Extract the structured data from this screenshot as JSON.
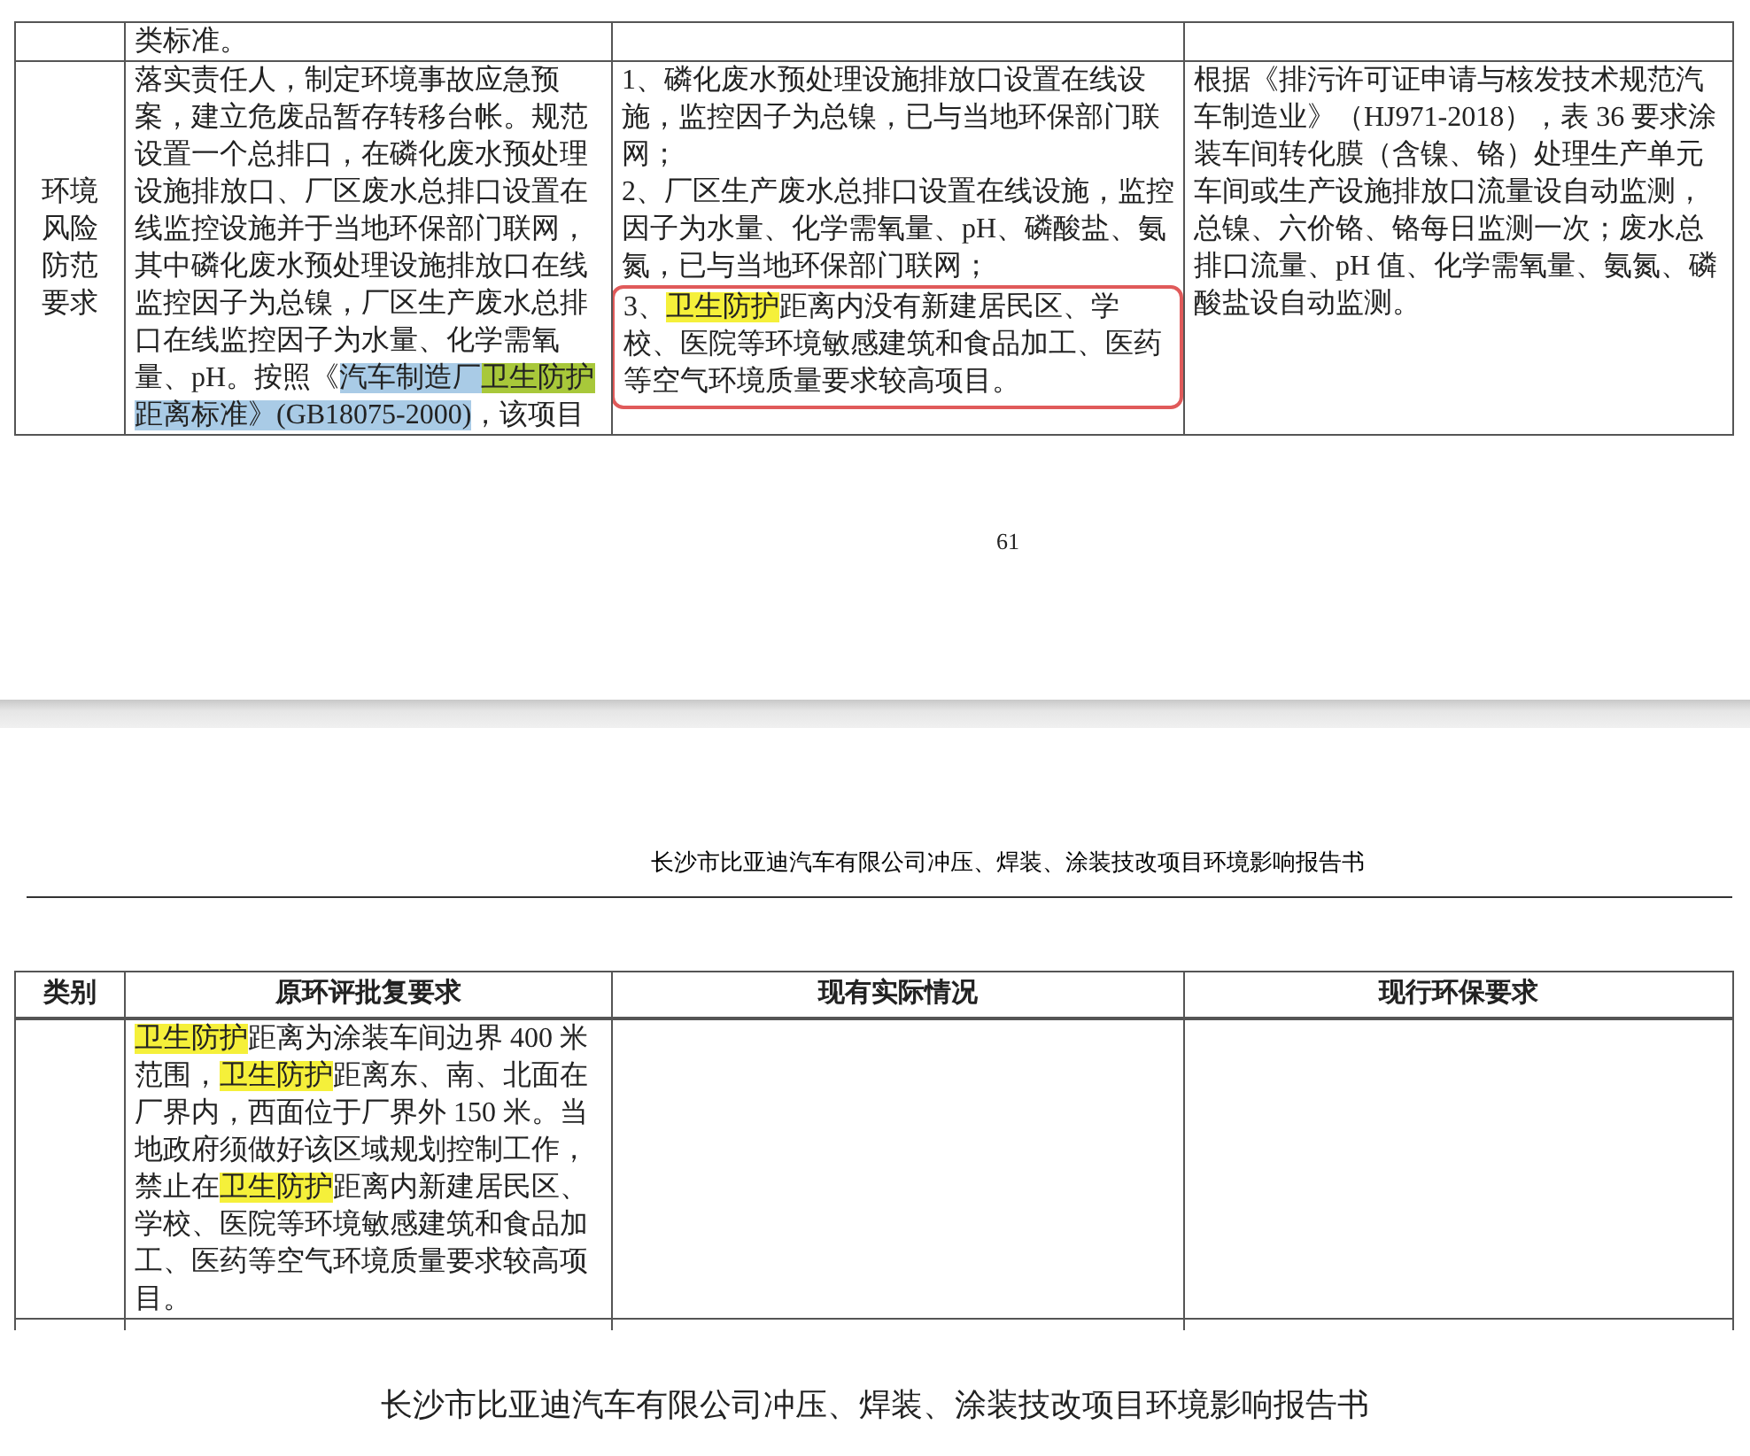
{
  "page_top": {
    "table": {
      "rows": [
        {
          "cells": [
            [],
            [
              {
                "segments": [
                  {
                    "text": "类标准。"
                  }
                ],
                "boxed": false
              }
            ],
            [],
            []
          ]
        },
        {
          "cells": [
            [
              {
                "segments": [
                  {
                    "text": "环境风险防范要求"
                  }
                ],
                "boxed": false
              }
            ],
            [
              {
                "segments": [
                  {
                    "text": "落实责任人，制定环境事故应急预案，建立危废品暂存转移台帐。规范设置一个总排口，在磷化废水预处理设施排放口、厂区废水总排口设置在线监控设施并于当地环保部门联网，其中磷化废水预处理设施排放口在线监控因子为总镍，厂区生产废水总排口在线监控因子为水量、化学需氧量、pH。按照《",
                    "highlighted": false,
                    "selected": false
                  },
                  {
                    "text": "汽车制造厂",
                    "highlighted": false,
                    "selected": true
                  },
                  {
                    "text": "卫生防护",
                    "highlighted": true,
                    "selected": true
                  },
                  {
                    "text": "距离标准》(GB18075-2000)",
                    "highlighted": false,
                    "selected": true
                  },
                  {
                    "text": "，该项目",
                    "highlighted": false,
                    "selected": false
                  }
                ],
                "boxed": false
              }
            ],
            [
              {
                "segments": [
                  {
                    "text": "1、磷化废水预处理设施排放口设置在线设施，监控因子为总镍，已与当地环保部门联网；"
                  }
                ],
                "boxed": false
              },
              {
                "segments": [
                  {
                    "text": "2、厂区生产废水总排口设置在线设施，监控因子为水量、化学需氧量、pH、磷酸盐、氨氮，已与当地环保部门联网；"
                  }
                ],
                "boxed": false
              },
              {
                "segments": [
                  {
                    "text": "3、",
                    "highlighted": false
                  },
                  {
                    "text": "卫生防护",
                    "highlighted": true
                  },
                  {
                    "text": "距离内没有新建居民区、学校、医院等环境敏感建筑和食品加工、医药等空气环境质量要求较高项目。",
                    "highlighted": false
                  }
                ],
                "boxed": true
              }
            ],
            [
              {
                "segments": [
                  {
                    "text": "根据《排污许可证申请与核发技术规范汽车制造业》（HJ971-2018），表 36 要求涂装车间转化膜（含镍、铬）处理生产单元车间或生产设施排放口流量设自动监测，总镍、六价铬、铬每日监测一次；废水总排口流量、pH 值、化学需氧量、氨氮、磷酸盐设自动监测。"
                  }
                ],
                "boxed": false
              }
            ]
          ]
        }
      ]
    },
    "page_number": "61"
  },
  "page_bottom": {
    "header": "长沙市比亚迪汽车有限公司冲压、焊装、涂装技改项目环境影响报告书",
    "table": {
      "columns": [
        "类别",
        "原环评批复要求",
        "现有实际情况",
        "现行环保要求"
      ],
      "rows": [
        {
          "cells": [
            [],
            [
              {
                "segments": [
                  {
                    "text": "卫生防护",
                    "highlighted": true
                  },
                  {
                    "text": "距离为涂装车间边界 400 米范围，",
                    "highlighted": false
                  },
                  {
                    "text": "卫生防护",
                    "highlighted": true
                  },
                  {
                    "text": "距离东、南、北面在厂界内，西面位于厂界外 150 米。当地政府须做好该区域规划控制工作，禁止在",
                    "highlighted": false
                  },
                  {
                    "text": "卫生防护",
                    "highlighted": true
                  },
                  {
                    "text": "距离内新建居民区、学校、医院等环境敏感建筑和食品加工、医药等空气环境质量要求较高项目。",
                    "highlighted": false
                  }
                ],
                "boxed": false
              }
            ],
            [],
            []
          ]
        }
      ]
    }
  },
  "footer": "长沙市比亚迪汽车有限公司冲压、焊装、涂装技改项目环境影响报告书"
}
